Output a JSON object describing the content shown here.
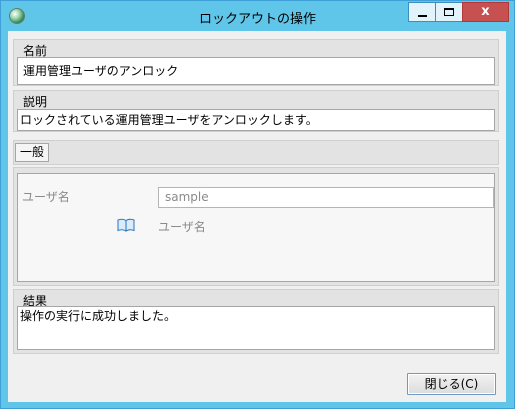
{
  "window": {
    "title": "ロックアウトの操作",
    "icon": "globe-icon",
    "controls": {
      "minimize": "minimize-icon",
      "maximize": "maximize-icon",
      "close_glyph": "x"
    }
  },
  "name_section": {
    "label": "名前",
    "value": "運用管理ユーザのアンロック"
  },
  "description_section": {
    "label": "説明",
    "value": "ロックされている運用管理ユーザをアンロックします。"
  },
  "tabs": [
    {
      "label": "一般",
      "selected": true
    }
  ],
  "parameters": {
    "username": {
      "label": "ユーザ名",
      "placeholder": "sample",
      "hint_icon": "book-icon",
      "hint": "ユーザ名"
    }
  },
  "result_section": {
    "label": "結果",
    "value": "操作の実行に成功しました。"
  },
  "buttons": {
    "close": "閉じる(C)"
  },
  "colors": {
    "titlebar": "#5fc6ea",
    "client_bg": "#f0f0f0",
    "close_button_red": "#c75050",
    "hint_text": "#8a8a8a"
  }
}
